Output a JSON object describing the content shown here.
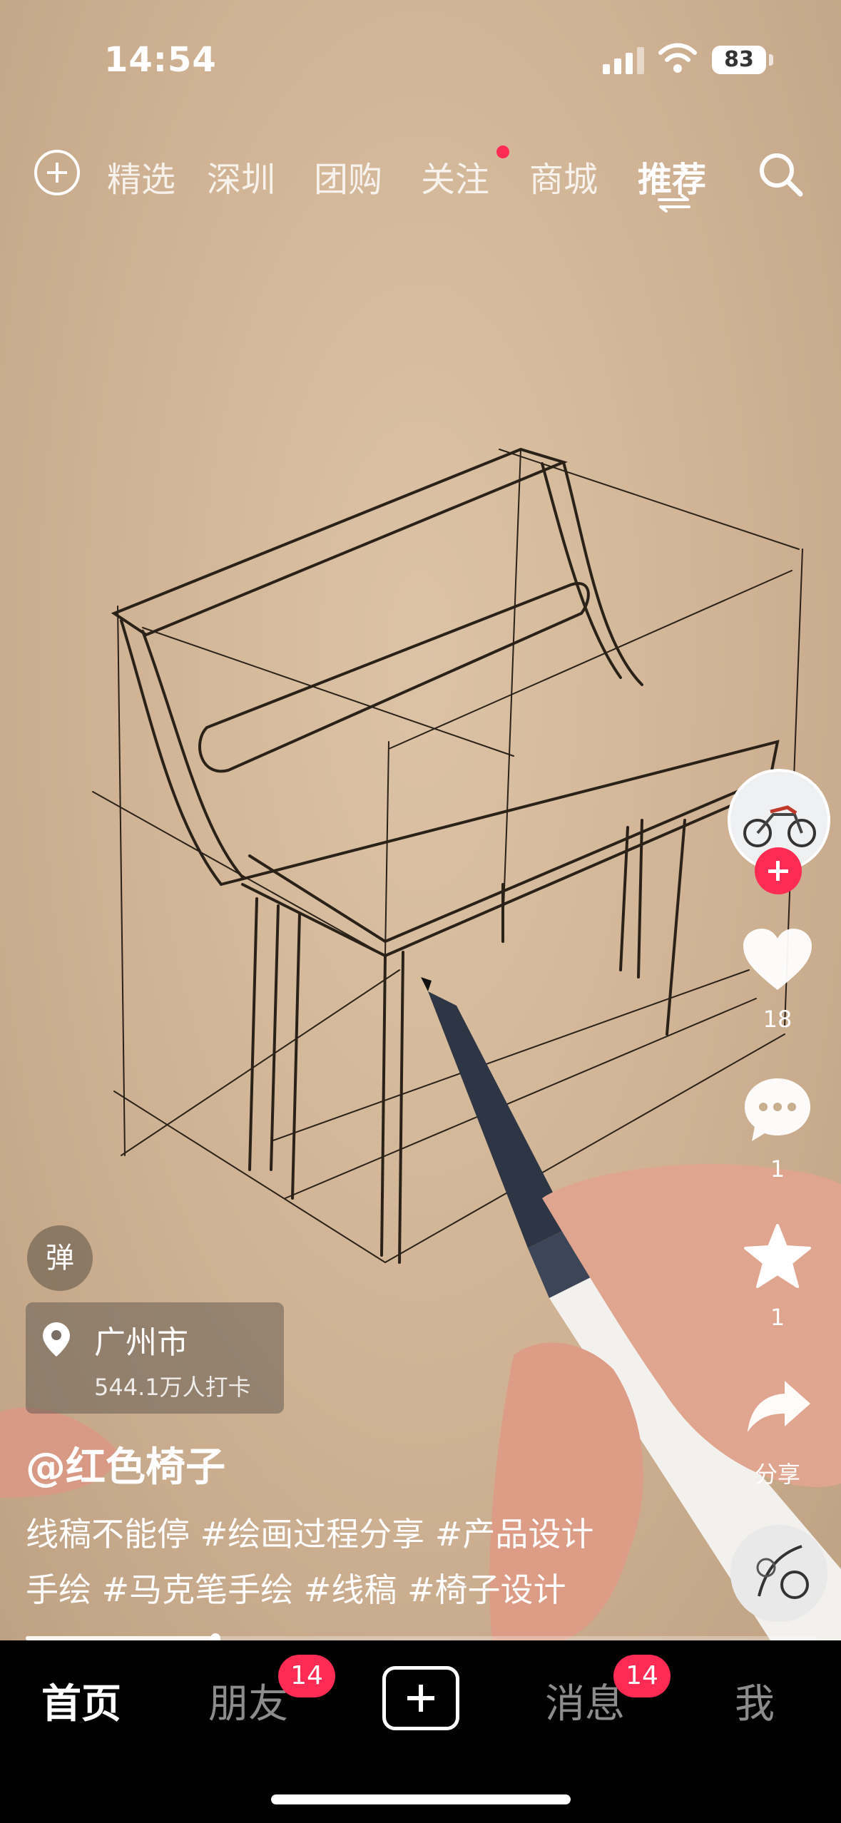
{
  "status_bar": {
    "time": "14:54",
    "battery": "83"
  },
  "top_nav": {
    "tabs": [
      {
        "label": "精选",
        "active": false
      },
      {
        "label": "深圳",
        "active": false
      },
      {
        "label": "团购",
        "active": false
      },
      {
        "label": "关注",
        "active": false,
        "has_dot": true
      },
      {
        "label": "商城",
        "active": false
      },
      {
        "label": "推荐",
        "active": true
      }
    ]
  },
  "side_rail": {
    "like_count": "18",
    "comment_count": "1",
    "favorite_count": "1",
    "share_label": "分享"
  },
  "overlay": {
    "danmu_label": "弹",
    "location": {
      "city": "广州市",
      "checkins": "544.1万人打卡"
    },
    "author": "@红色椅子",
    "caption_line1": "线稿不能停 #绘画过程分享 #产品设计",
    "caption_line2": "手绘 #马克笔手绘 #线稿 #椅子设计",
    "progress": 0.24
  },
  "bottom_nav": {
    "home": "首页",
    "friends": "朋友",
    "friends_badge": "14",
    "messages": "消息",
    "messages_badge": "14",
    "me": "我"
  },
  "colors": {
    "accent": "#fe2c55",
    "paper": "#d8bea1",
    "ink": "#2a2118"
  }
}
